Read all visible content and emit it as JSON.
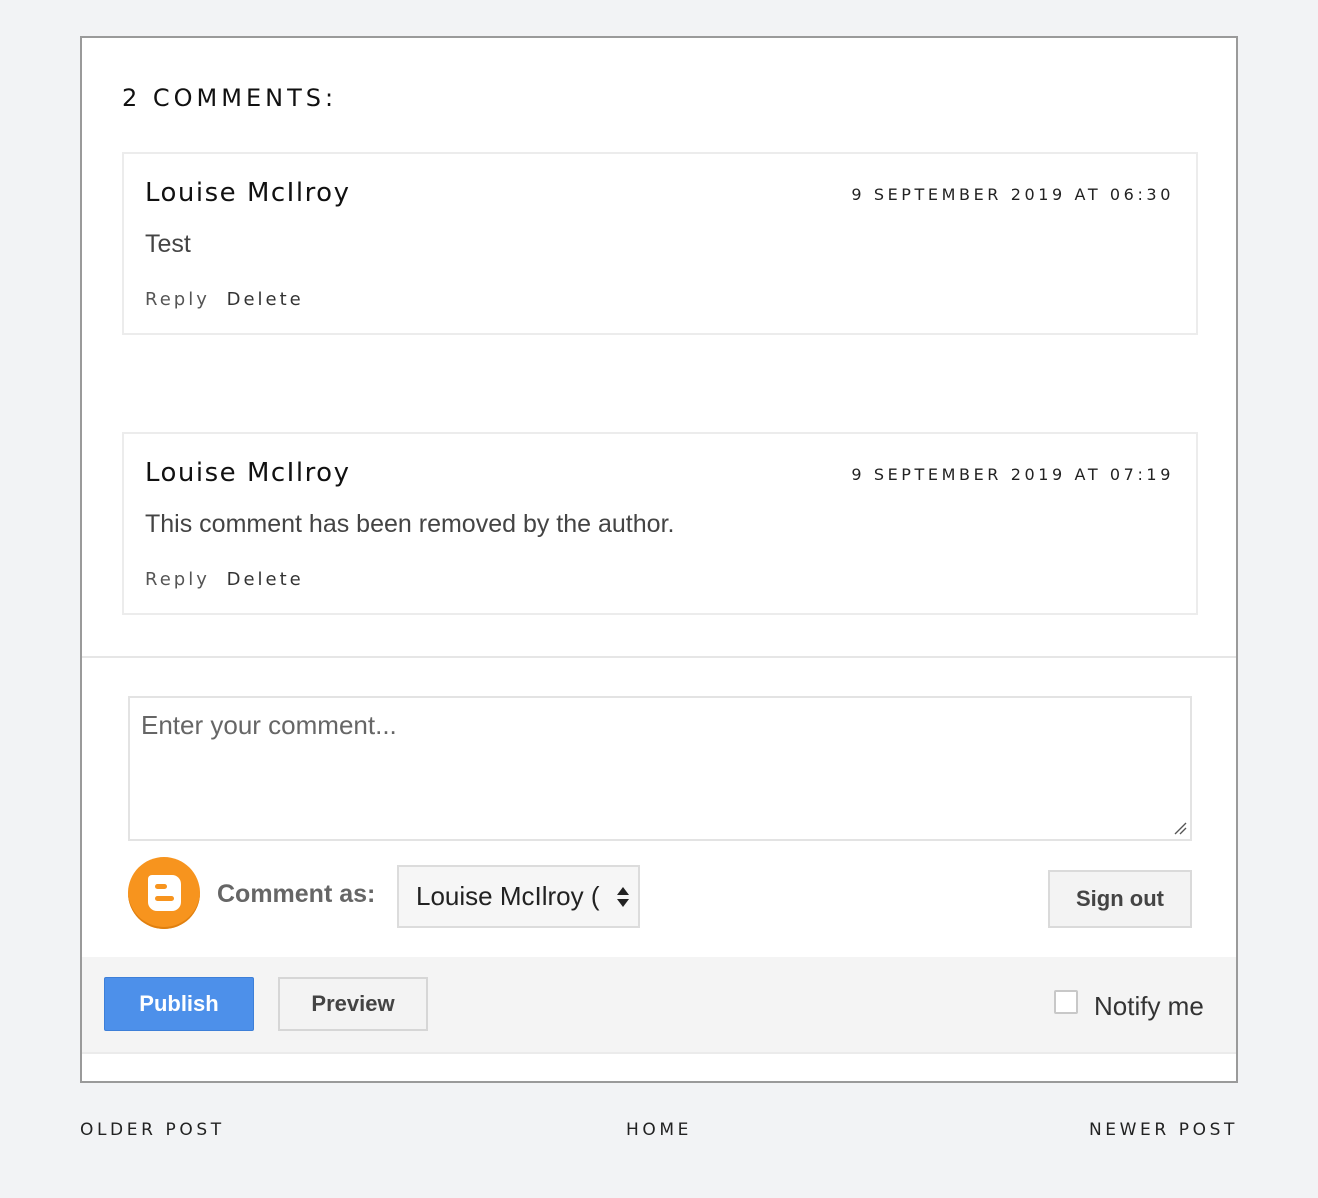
{
  "comments_header": "2 COMMENTS:",
  "comments": [
    {
      "author": "Louise McIlroy",
      "timestamp": "9 SEPTEMBER 2019 AT 06:30",
      "body": "Test",
      "reply_label": "Reply",
      "delete_label": "Delete"
    },
    {
      "author": "Louise McIlroy",
      "timestamp": "9 SEPTEMBER 2019 AT 07:19",
      "body": "This comment has been removed by the author.",
      "reply_label": "Reply",
      "delete_label": "Delete"
    }
  ],
  "form": {
    "placeholder": "Enter your comment...",
    "comment_as_label": "Comment as:",
    "identity_value": "Louise McIlroy (",
    "sign_out_label": "Sign out",
    "publish_label": "Publish",
    "preview_label": "Preview",
    "notify_label": "Notify me",
    "notify_checked": false
  },
  "icons": {
    "logo": "blogger-logo-icon",
    "select_arrows": "select-arrows-icon",
    "resize": "resize-grip-icon"
  },
  "colors": {
    "publish_bg": "#4d90ea",
    "blogger_orange": "#f7941e",
    "page_bg": "#f2f3f5"
  },
  "navigation": {
    "older": "OLDER POST",
    "home": "HOME",
    "newer": "NEWER POST"
  }
}
